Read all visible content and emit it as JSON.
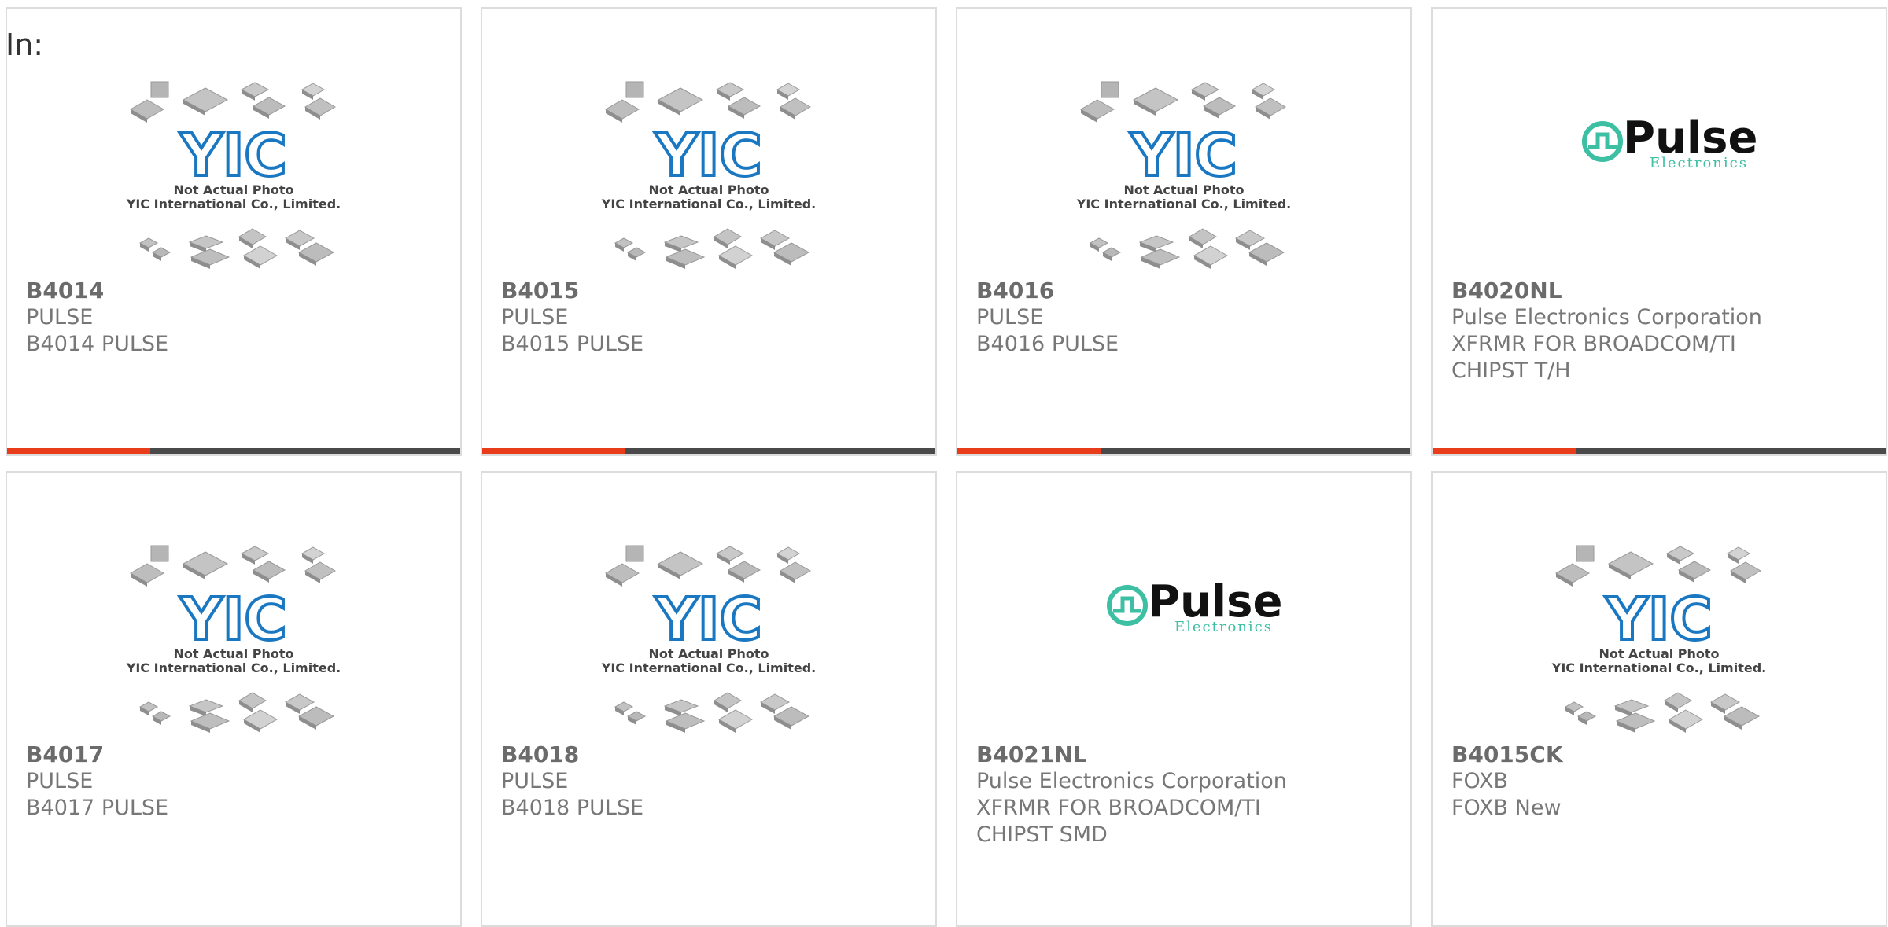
{
  "page": {
    "in_label": "In:"
  },
  "placeholder": {
    "line1": "Not Actual Photo",
    "line2": "YIC International Co., Limited.",
    "logo_text": "YIC"
  },
  "pulse_logo": {
    "word": "Pulse",
    "sub": "Electronics"
  },
  "colors": {
    "accent": "#e83c1a",
    "bar": "#4a4a4a",
    "text": "#777777",
    "yic_blue": "#1a78c2",
    "pulse_teal": "#3cbfa3"
  },
  "products": [
    {
      "part": "B4014",
      "mfr": "PULSE",
      "desc1": "B4014 PULSE",
      "desc2": "",
      "image": "yic-placeholder"
    },
    {
      "part": "B4015",
      "mfr": "PULSE",
      "desc1": "B4015 PULSE",
      "desc2": "",
      "image": "yic-placeholder"
    },
    {
      "part": "B4016",
      "mfr": "PULSE",
      "desc1": "B4016 PULSE",
      "desc2": "",
      "image": "yic-placeholder"
    },
    {
      "part": "B4020NL",
      "mfr": "Pulse Electronics Corporation",
      "desc1": "XFRMR FOR BROADCOM/TI",
      "desc2": "CHIPST T/H",
      "image": "pulse-logo"
    },
    {
      "part": "B4017",
      "mfr": "PULSE",
      "desc1": "B4017 PULSE",
      "desc2": "",
      "image": "yic-placeholder"
    },
    {
      "part": "B4018",
      "mfr": "PULSE",
      "desc1": "B4018 PULSE",
      "desc2": "",
      "image": "yic-placeholder"
    },
    {
      "part": "B4021NL",
      "mfr": "Pulse Electronics Corporation",
      "desc1": "XFRMR FOR BROADCOM/TI",
      "desc2": "CHIPST SMD",
      "image": "pulse-logo"
    },
    {
      "part": "B4015CK",
      "mfr": "FOXB",
      "desc1": "FOXB New",
      "desc2": "",
      "image": "yic-placeholder"
    }
  ]
}
